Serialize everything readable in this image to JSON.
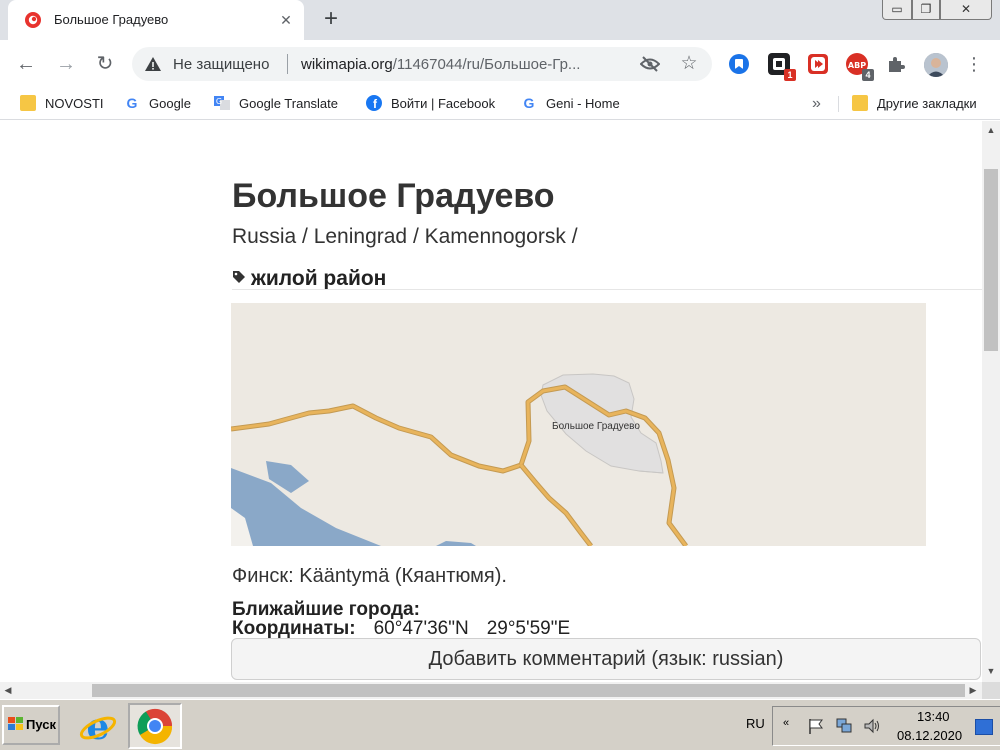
{
  "browser": {
    "tab_title": "Большое Градуево",
    "tab_close": "✕",
    "new_tab": "+",
    "window": {
      "minimize": "▭",
      "maximize": "❐",
      "close": "✕"
    },
    "nav": {
      "back": "←",
      "forward": "→",
      "reload": "↻"
    },
    "omnibox": {
      "security_text": "Не защищено",
      "url_domain": "wikimapia.org",
      "url_path": "/11467044/ru/Большое-Гр..."
    },
    "extensions": [
      {
        "name": "blue-extension",
        "color": "#1a73e8",
        "badge": ""
      },
      {
        "name": "black-extension",
        "color": "#202124",
        "badge": "1"
      },
      {
        "name": "red-extension",
        "color": "#d93025",
        "badge": ""
      },
      {
        "name": "abp-extension",
        "color": "#d93025",
        "badge": "4"
      }
    ],
    "menu": "⋮"
  },
  "bookmarks": {
    "items": [
      {
        "label": "NOVOSTI",
        "icon": "folder-icon"
      },
      {
        "label": "Google",
        "icon": "google-icon"
      },
      {
        "label": "Google Translate",
        "icon": "translate-icon"
      },
      {
        "label": "Войти | Facebook",
        "icon": "facebook-icon"
      },
      {
        "label": "Geni - Home",
        "icon": "google-icon"
      }
    ],
    "more": "»",
    "other": "Другие закладки"
  },
  "page": {
    "title": "Большое Градуево",
    "breadcrumb": "Russia / Leningrad / Kamennogorsk /",
    "category": "жилой район",
    "map_label": "Большое Градуево",
    "finnish_name": "Финск: Kääntymä (Кяантюмя).",
    "nearest_label": "Ближайшие города:",
    "coords_label": "Координаты:",
    "lat": "60°47'36\"N",
    "lon": "29°5'59\"E",
    "comment_button": "Добавить комментарий (язык: russian)"
  },
  "taskbar": {
    "start": "Пуск",
    "lang": "RU",
    "time": "13:40",
    "date": "08.12.2020",
    "tray_chevron": "«"
  },
  "colors": {
    "map_bg": "#ede9e2",
    "road": "#e8b45c",
    "water": "#8aa8c8",
    "district": "#e1e0e0"
  }
}
